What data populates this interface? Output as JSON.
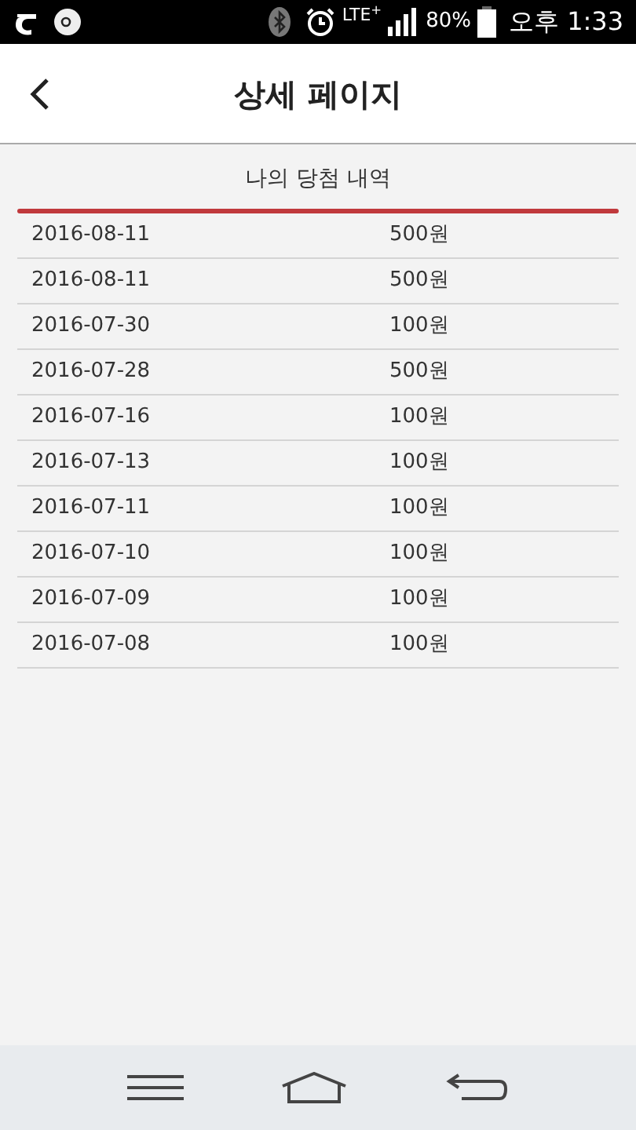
{
  "status_bar": {
    "network": "LTE$^{+}$",
    "battery": "80%",
    "time": "오후 1:33"
  },
  "header": {
    "title": "상세 페이지"
  },
  "section": {
    "title": "나의 당첨 내역"
  },
  "rows": [
    {
      "date": "2016-08-11",
      "amount": "500원"
    },
    {
      "date": "2016-08-11",
      "amount": "500원"
    },
    {
      "date": "2016-07-30",
      "amount": "100원"
    },
    {
      "date": "2016-07-28",
      "amount": "500원"
    },
    {
      "date": "2016-07-16",
      "amount": "100원"
    },
    {
      "date": "2016-07-13",
      "amount": "100원"
    },
    {
      "date": "2016-07-11",
      "amount": "100원"
    },
    {
      "date": "2016-07-10",
      "amount": "100원"
    },
    {
      "date": "2016-07-09",
      "amount": "100원"
    },
    {
      "date": "2016-07-08",
      "amount": "100원"
    }
  ]
}
